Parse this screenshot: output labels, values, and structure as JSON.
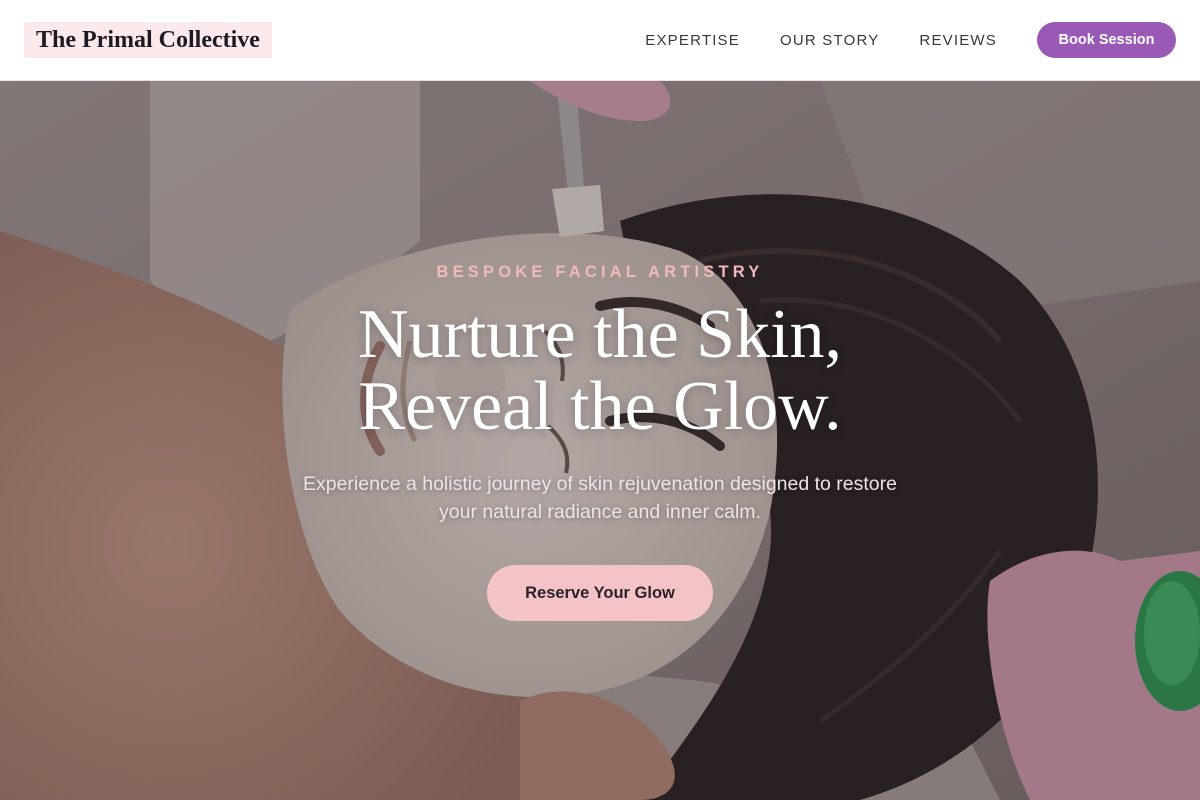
{
  "brand": {
    "name": "The Primal Collective"
  },
  "nav": {
    "links": [
      "EXPERTISE",
      "OUR STORY",
      "REVIEWS"
    ],
    "cta_label": "Book Session"
  },
  "hero": {
    "eyebrow": "BESPOKE FACIAL ARTISTRY",
    "headline_line1": "Nurture the Skin,",
    "headline_line2": "Reveal the Glow.",
    "subtext_line1": "Experience a holistic journey of skin rejuvenation designed to restore",
    "subtext_line2": "your natural radiance and inner calm.",
    "cta_label": "Reserve Your Glow",
    "image_subject": "man lying on spa towel receiving facial mask applied with brush by gloved hands"
  },
  "colors": {
    "accent_purple": "#9b59b6",
    "accent_pink": "#f4c3c8",
    "eyebrow_pink": "#f2b8c0",
    "logo_bg": "#fbe9ec",
    "text_dark": "#1e1a24"
  }
}
